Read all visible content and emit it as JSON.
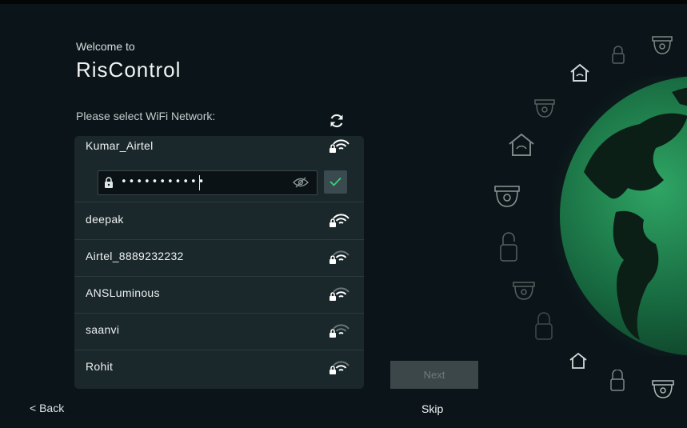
{
  "header": {
    "welcome": "Welcome to",
    "brand": "RisControl"
  },
  "wifi": {
    "label": "Please select WiFi Network:",
    "refresh_icon": "refresh-icon",
    "selected": {
      "name": "Kumar_Airtel",
      "password_mask": "•••••••••••",
      "password_value_hidden": true
    },
    "networks": [
      {
        "name": "deepak",
        "signal": "strong",
        "secured": true
      },
      {
        "name": "Airtel_8889232232",
        "signal": "medium",
        "secured": true
      },
      {
        "name": "ANSLuminous",
        "signal": "medium",
        "secured": true
      },
      {
        "name": "saanvi",
        "signal": "weak",
        "secured": true
      },
      {
        "name": "Rohit",
        "signal": "medium",
        "secured": true
      }
    ]
  },
  "footer": {
    "next_label": "Next",
    "skip_label": "Skip",
    "back_label": "< Back"
  },
  "colors": {
    "accent": "#38d17a",
    "background": "#0b1519",
    "panel": "#1a272b",
    "globe": "#1d7a4a"
  }
}
